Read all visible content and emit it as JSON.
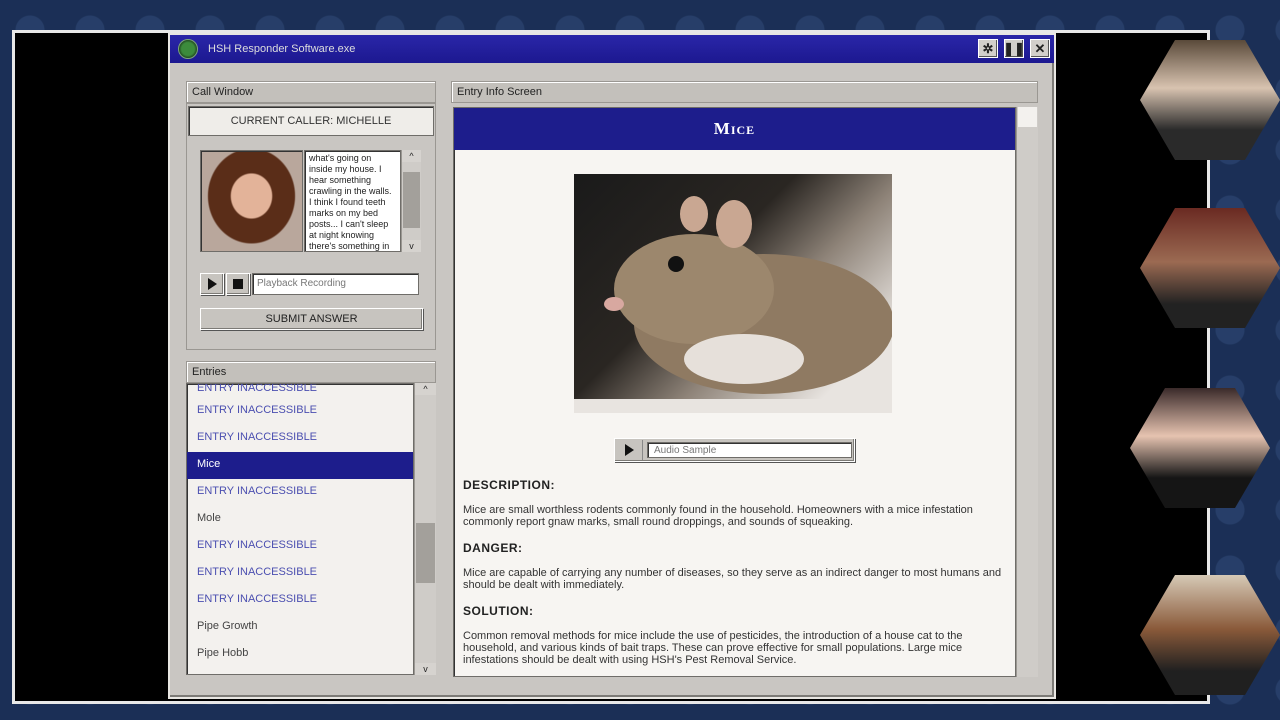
{
  "window": {
    "title": "HSH Responder Software.exe"
  },
  "call_window": {
    "header": "Call Window",
    "caller_label": "CURRENT CALLER: MICHELLE",
    "transcript": "what's going on inside my house. I hear something crawling in the walls. I think I found teeth marks on my bed posts... I can't sleep at night knowing there's something in",
    "playback_placeholder": "Playback Recording",
    "submit_label": "SUBMIT ANSWER"
  },
  "entries": {
    "header": "Entries",
    "items": [
      {
        "label": "ENTRY INACCESSIBLE",
        "state": "locked"
      },
      {
        "label": "ENTRY INACCESSIBLE",
        "state": "locked"
      },
      {
        "label": "ENTRY INACCESSIBLE",
        "state": "locked"
      },
      {
        "label": "Mice",
        "state": "selected"
      },
      {
        "label": "ENTRY INACCESSIBLE",
        "state": "locked"
      },
      {
        "label": "Mole",
        "state": "known"
      },
      {
        "label": "ENTRY INACCESSIBLE",
        "state": "locked"
      },
      {
        "label": "ENTRY INACCESSIBLE",
        "state": "locked"
      },
      {
        "label": "ENTRY INACCESSIBLE",
        "state": "locked"
      },
      {
        "label": "Pipe Growth",
        "state": "known"
      },
      {
        "label": "Pipe Hobb",
        "state": "known"
      }
    ]
  },
  "entry_info": {
    "header": "Entry Info Screen",
    "title": "Mice",
    "audio_label": "Audio Sample",
    "description_head": "DESCRIPTION:",
    "description": "Mice are small worthless rodents commonly found in the household. Homeowners with a mice infestation commonly report gnaw marks, small round droppings, and sounds of squeaking.",
    "danger_head": "DANGER:",
    "danger": "Mice are capable of carrying any number of diseases, so they serve as an indirect danger to most humans and should be dealt with immediately.",
    "solution_head": "SOLUTION:",
    "solution": "Common removal methods for mice include the use of pesticides, the introduction of a house cat to the household, and various kinds of bait traps. These can prove effective for small populations. Large mice infestations should be dealt with using HSH's Pest Removal Service."
  },
  "colors": {
    "title_bar": "#1c1890",
    "selection": "#1d1d8c",
    "locked_entry": "#4b4fb0"
  }
}
